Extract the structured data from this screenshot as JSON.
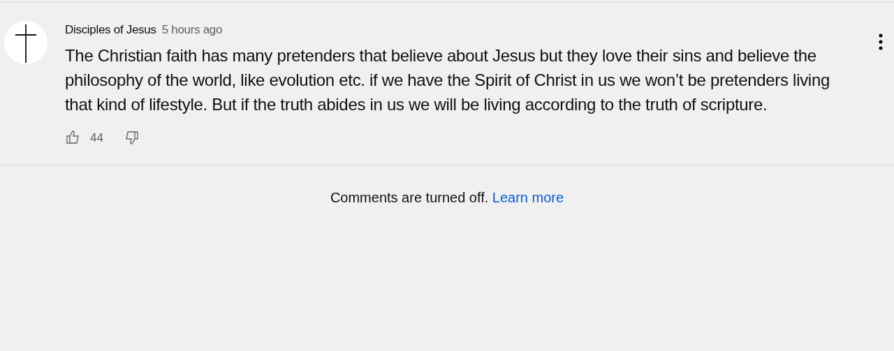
{
  "comment": {
    "author": "Disciples of Jesus",
    "time": "5 hours ago",
    "text": "The Christian faith has many pretenders that believe about Jesus but they love their sins and believe the philosophy of the world, like evolution etc. if we have the Spirit of Christ in us we won’t be pretenders living that kind of lifestyle. But if the truth abides in us we will be living according to the truth of scripture.",
    "likes": "44"
  },
  "notice": {
    "text": "Comments are turned off.",
    "link": "Learn more"
  }
}
